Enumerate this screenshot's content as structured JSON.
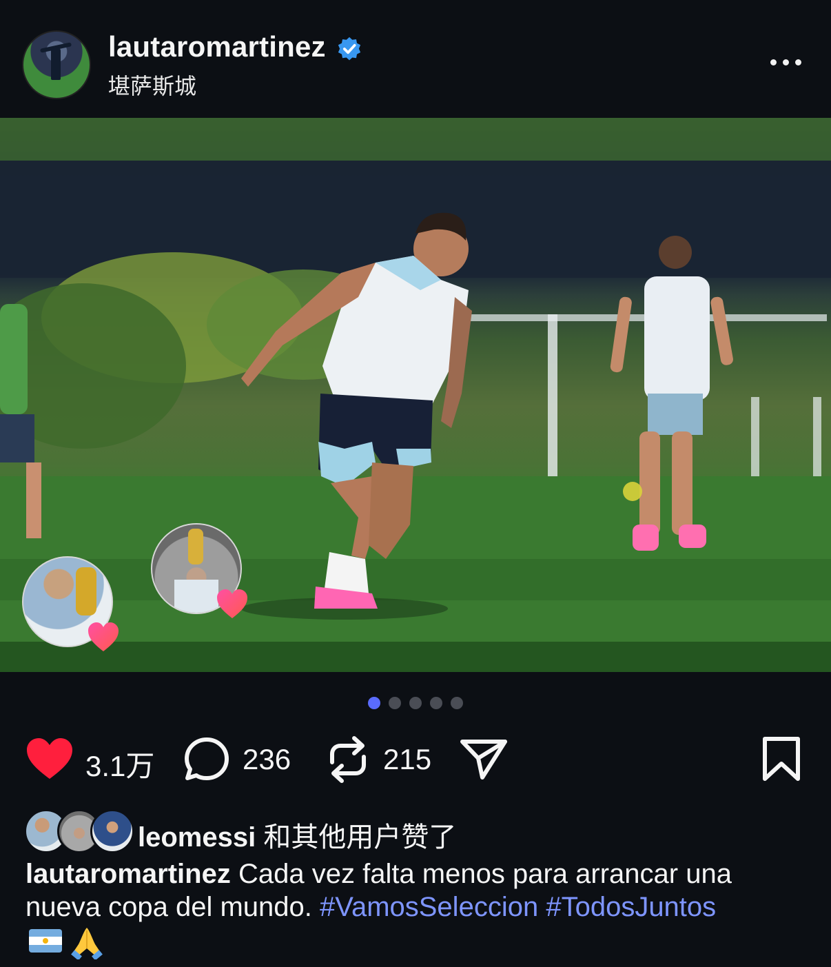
{
  "post": {
    "username": "lautaromartinez",
    "location": "堪萨斯城",
    "likes_count": "3.1万",
    "comments_count": "236",
    "reposts_count": "215",
    "liked_by_user": "leomessi",
    "liked_by_suffix": "和其他用户赞了",
    "caption_user": "lautaromartinez",
    "caption_text": "Cada vez falta menos para arrancar una nueva copa del mundo.",
    "hashtags": [
      "#VamosSeleccion",
      "#TodosJuntos"
    ],
    "caption_emojis": [
      "argentina-flag",
      "folded-hands"
    ],
    "carousel": {
      "total": 5,
      "active": 1
    },
    "verified": true
  },
  "icons": {
    "more": "more-horizontal-icon",
    "like": "heart-icon",
    "comment": "comment-bubble-icon",
    "repost": "repost-icon",
    "share": "send-icon",
    "save": "bookmark-icon"
  },
  "colors": {
    "background": "#0c0f14",
    "accent": "#5a6cff",
    "hashtag": "#7e95ff",
    "like": "#ff1f3d",
    "verified": "#3897f0"
  }
}
